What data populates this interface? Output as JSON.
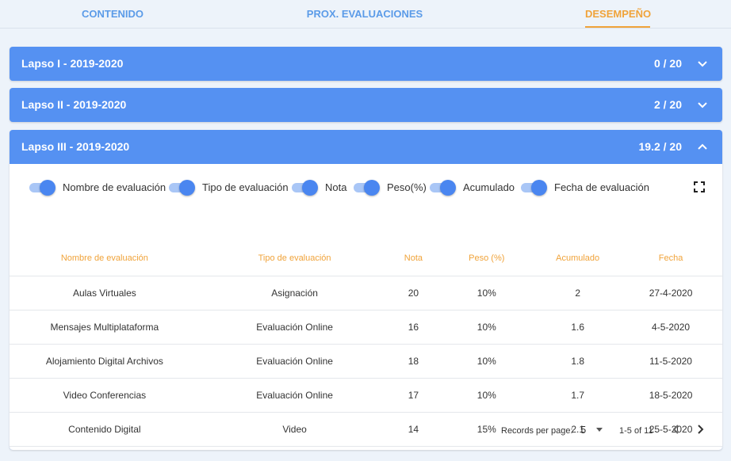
{
  "tabs": [
    {
      "label": "CONTENIDO",
      "active": false
    },
    {
      "label": "PROX. EVALUACIONES",
      "active": false
    },
    {
      "label": "DESEMPEÑO",
      "active": true
    }
  ],
  "lapsos": [
    {
      "title": "Lapso I - 2019-2020",
      "score": "0 / 20",
      "expanded": false
    },
    {
      "title": "Lapso II - 2019-2020",
      "score": "2 / 20",
      "expanded": false
    },
    {
      "title": "Lapso III - 2019-2020",
      "score": "19.2 / 20",
      "expanded": true
    }
  ],
  "toggles": [
    {
      "label": "Nombre de evaluación",
      "on": true
    },
    {
      "label": "Tipo de evaluación",
      "on": true
    },
    {
      "label": "Nota",
      "on": true
    },
    {
      "label": "Peso(%)",
      "on": true
    },
    {
      "label": "Acumulado",
      "on": true
    },
    {
      "label": "Fecha de evaluación",
      "on": true
    }
  ],
  "table": {
    "headers": [
      "Nombre de evaluación",
      "Tipo de evaluación",
      "Nota",
      "Peso (%)",
      "Acumulado",
      "Fecha"
    ],
    "rows": [
      [
        "Aulas Virtuales",
        "Asignación",
        "20",
        "10%",
        "2",
        "27-4-2020"
      ],
      [
        "Mensajes Multiplataforma",
        "Evaluación Online",
        "16",
        "10%",
        "1.6",
        "4-5-2020"
      ],
      [
        "Alojamiento Digital Archivos",
        "Evaluación Online",
        "18",
        "10%",
        "1.8",
        "11-5-2020"
      ],
      [
        "Video Conferencias",
        "Evaluación Online",
        "17",
        "10%",
        "1.7",
        "18-5-2020"
      ],
      [
        "Contenido Digital",
        "Video",
        "14",
        "15%",
        "2.1",
        "25-5-2020"
      ]
    ]
  },
  "pager": {
    "records_label": "Records per page:",
    "records_value": "5",
    "range": "1-5 of 11"
  },
  "icons": {
    "chevron_down": "chevron-down-icon",
    "chevron_up": "chevron-up-icon",
    "fullscreen": "fullscreen-icon",
    "prev": "chevron-left-icon",
    "next": "chevron-right-icon"
  },
  "colors": {
    "accent_blue": "#5591f2",
    "accent_orange": "#f0a33a",
    "tab_blue": "#5b9be8"
  }
}
